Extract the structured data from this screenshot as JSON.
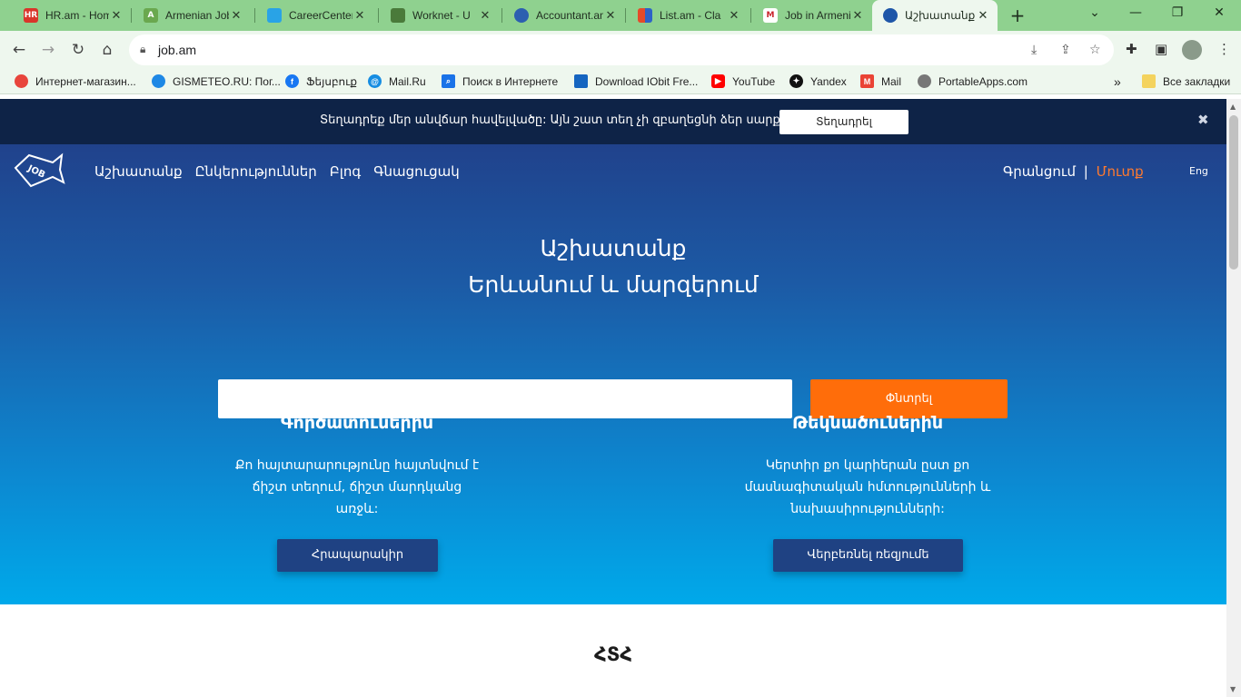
{
  "browser": {
    "tabs": [
      {
        "title": "HR.am - Home",
        "fav_color": "#d9352b",
        "fav_text": "HR"
      },
      {
        "title": "Armenian Jobs",
        "fav_color": "#6aa84f",
        "fav_text": "A"
      },
      {
        "title": "CareerCenter",
        "fav_color": "#29a3e6",
        "fav_text": ""
      },
      {
        "title": "Worknet - U",
        "fav_color": "#4a7a3a",
        "fav_text": ""
      },
      {
        "title": "Accountant.am",
        "fav_color": "#2c5fb0",
        "fav_text": ""
      },
      {
        "title": "List.am - Cla",
        "fav_color": "#e54a2a",
        "fav_text": ""
      },
      {
        "title": "Job in Armenia",
        "fav_color": "#c8252c",
        "fav_text": "M"
      },
      {
        "title": "Աշխատանք",
        "fav_color": "#1e56a8",
        "fav_text": ""
      }
    ],
    "url": "job.am",
    "bookmarks": [
      {
        "label": "Интернет-магазин...",
        "color": "#e8453c"
      },
      {
        "label": "GISMETEO.RU: Пог...",
        "color": "#1e88e5"
      },
      {
        "label": "Ֆեյսբուք",
        "color": "#1877f2"
      },
      {
        "label": "Mail.Ru",
        "color": "#168de2"
      },
      {
        "label": "Поиск в Интернете",
        "color": "#1a73e8"
      },
      {
        "label": "Download IObit Fre...",
        "color": "#1565c0"
      },
      {
        "label": "YouTube",
        "color": "#ff0000"
      },
      {
        "label": "Yandex",
        "color": "#111111"
      },
      {
        "label": "Mail",
        "color": "#ea4335"
      },
      {
        "label": "PortableApps.com",
        "color": "#777777"
      }
    ],
    "all_bookmarks": "Все закладки"
  },
  "notice": {
    "message": "Տեղադրեք մեր անվճար հավելվածը: Այն շատ տեղ չի զբաղեցնի ձեր սարքի վրա",
    "button": "Տեղադրել"
  },
  "nav": {
    "items": [
      "Աշխատանք",
      "Ընկերություններ",
      "Բլոգ",
      "Գնացուցակ"
    ],
    "register": "Գրանցում",
    "separator": "|",
    "login": "Մուտք",
    "lang": "Eng"
  },
  "hero": {
    "line1": "Աշխատանք",
    "line2": "Երևանում և մարզերում",
    "search_placeholder": "",
    "search_button": "Փնտրել"
  },
  "employers": {
    "title": "Գործատուներին",
    "text_l1": "Քո հայտարարությունը հայտնվում է",
    "text_l2": "ճիշտ տեղում, ճիշտ մարդկանց",
    "text_l3": "առջև:",
    "button": "Հրապարակիր"
  },
  "candidates": {
    "title": "Թեկնածուներին",
    "text_l1": "Կերտիր քո կարիերան ըստ քո",
    "text_l2": "մասնագիտական հմտությունների և",
    "text_l3": "նախասիրությունների:",
    "button": "Վերբեռնել ռեզյումե"
  },
  "faq": {
    "title": "ՀՏՀ"
  },
  "colors": {
    "orange": "#ff6d0a",
    "navy": "#0e2347",
    "hero_top": "#20428c",
    "hero_bottom": "#00a9ea"
  }
}
